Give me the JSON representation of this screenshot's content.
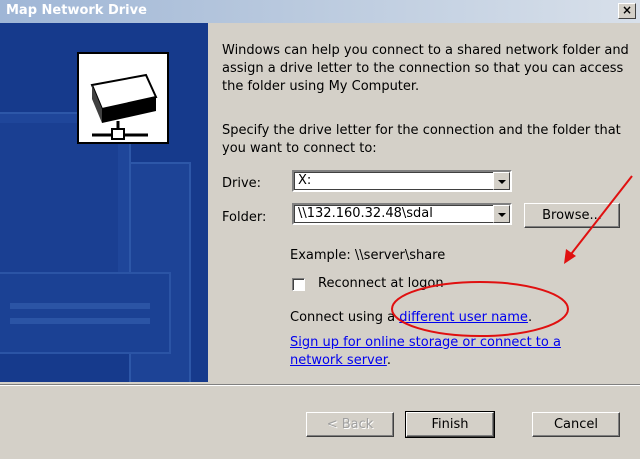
{
  "window": {
    "title": "Map Network Drive",
    "close_glyph": "×"
  },
  "intro_text": "Windows can help you connect to a shared network folder and assign a drive letter to the connection so that you can access the folder using My Computer.",
  "instruction_text": "Specify the drive letter for the connection and the folder that you want to connect to:",
  "drive": {
    "label": "Drive:",
    "value": "X:"
  },
  "folder": {
    "label": "Folder:",
    "value": "\\\\132.160.32.48\\sdal"
  },
  "browse_label": "Browse...",
  "example_text": "Example: \\\\server\\share",
  "reconnect": {
    "label": "Reconnect at logon",
    "checked": false
  },
  "connect_using": {
    "prefix": "Connect using a ",
    "link": "different user name",
    "suffix": "."
  },
  "signup": {
    "link": "Sign up for online storage or connect to a network server",
    "suffix": "."
  },
  "buttons": {
    "back": "< Back",
    "finish": "Finish",
    "cancel": "Cancel"
  },
  "colors": {
    "side_panel": "#163a8c",
    "dialog": "#d4d0c8",
    "link": "#0000ee",
    "annotation": "#e01010"
  },
  "icons": [
    "close-icon",
    "network-drive-icon",
    "dropdown-arrow-icon",
    "checkbox-icon"
  ]
}
